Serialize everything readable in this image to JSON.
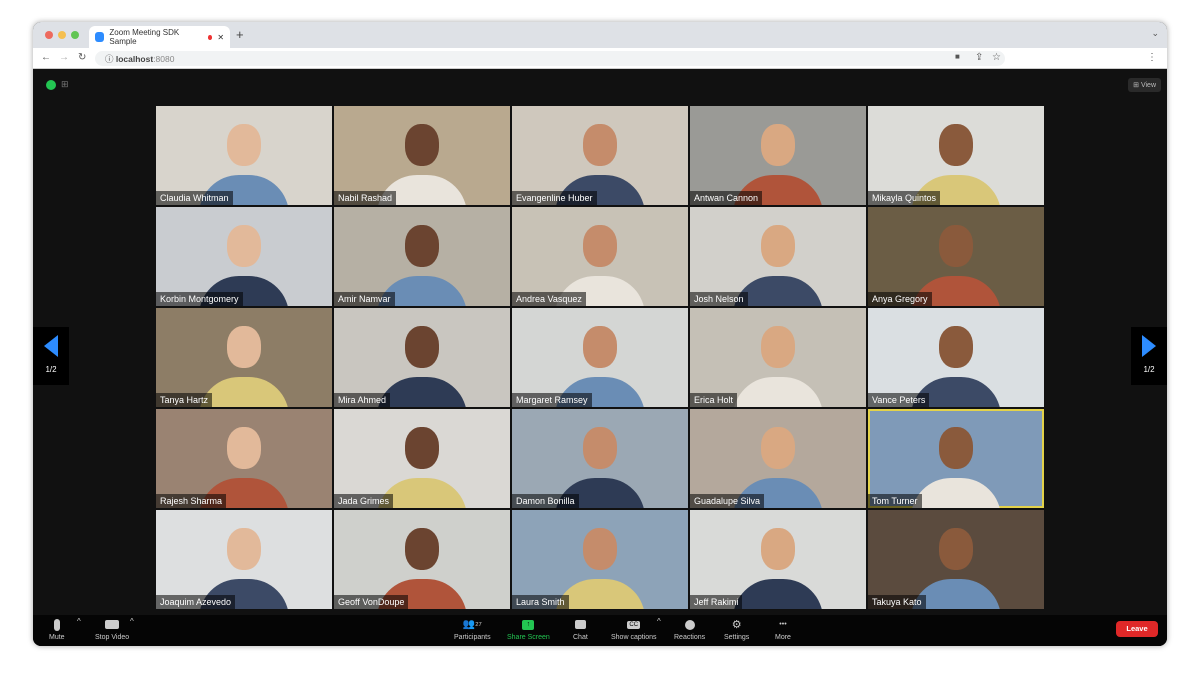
{
  "browser": {
    "tab_title": "Zoom Meeting SDK Sample",
    "url_host": "localhost",
    "url_port": ":8080"
  },
  "meeting": {
    "view_label": "View",
    "page_indicator_left": "1/2",
    "page_indicator_right": "1/2",
    "active_speaker": "Tom Turner",
    "highlight_color": "#e3d24a"
  },
  "participants": [
    "Claudia Whitman",
    "Nabil Rashad",
    "Evangenline Huber",
    "Antwan Cannon",
    "Mikayla Quintos",
    "Korbin Montgomery",
    "Amir Namvar",
    "Andrea Vasquez",
    "Josh Nelson",
    "Anya Gregory",
    "Tanya Hartz",
    "Mira Ahmed",
    "Margaret Ramsey",
    "Erica Holt",
    "Vance Peters",
    "Rajesh Sharma",
    "Jada Grimes",
    "Damon Bonilla",
    "Guadalupe Silva",
    "Tom Turner",
    "Joaquim Azevedo",
    "Geoff VonDoupe",
    "Laura Smith",
    "Jeff Rakimi",
    "Takuya Kato"
  ],
  "toolbar": {
    "mute": "Mute",
    "stop_video": "Stop Video",
    "participants": "Participants",
    "participants_count": "27",
    "share_screen": "Share Screen",
    "chat": "Chat",
    "captions": "Show captions",
    "captions_icon": "CC",
    "reactions": "Reactions",
    "settings": "Settings",
    "more": "More",
    "more_icon": "•••",
    "leave": "Leave",
    "share_color": "#23c552",
    "leave_color": "#e02828"
  }
}
